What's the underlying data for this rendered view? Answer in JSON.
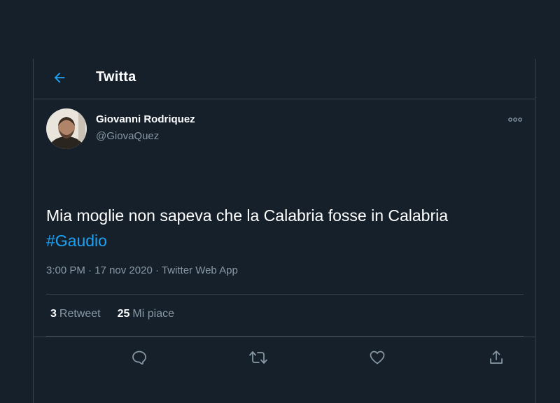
{
  "header": {
    "title": "Twitta",
    "back_icon": "arrow-left-icon"
  },
  "tweet": {
    "author_name": "Giovanni Rodriquez",
    "author_handle": "@GiovaQuez",
    "text": "Mia moglie non sapeva che la Calabria fosse in Calabria",
    "hashtag": "#Gaudio",
    "time": "3:00 PM",
    "separator": " · ",
    "date": "17 nov 2020",
    "source": "Twitter Web App",
    "more_icon": "more-options-icon"
  },
  "stats": {
    "retweets_count": "3",
    "retweets_label": "Retweet",
    "likes_count": "25",
    "likes_label": "Mi piace"
  },
  "actions": {
    "reply_icon": "reply-icon",
    "retweet_icon": "retweet-icon",
    "like_icon": "heart-icon",
    "share_icon": "share-icon"
  },
  "colors": {
    "background": "#15202b",
    "border": "#38444d",
    "accent": "#1da1f2",
    "secondary_text": "#8899a6",
    "primary_text": "#ffffff"
  }
}
